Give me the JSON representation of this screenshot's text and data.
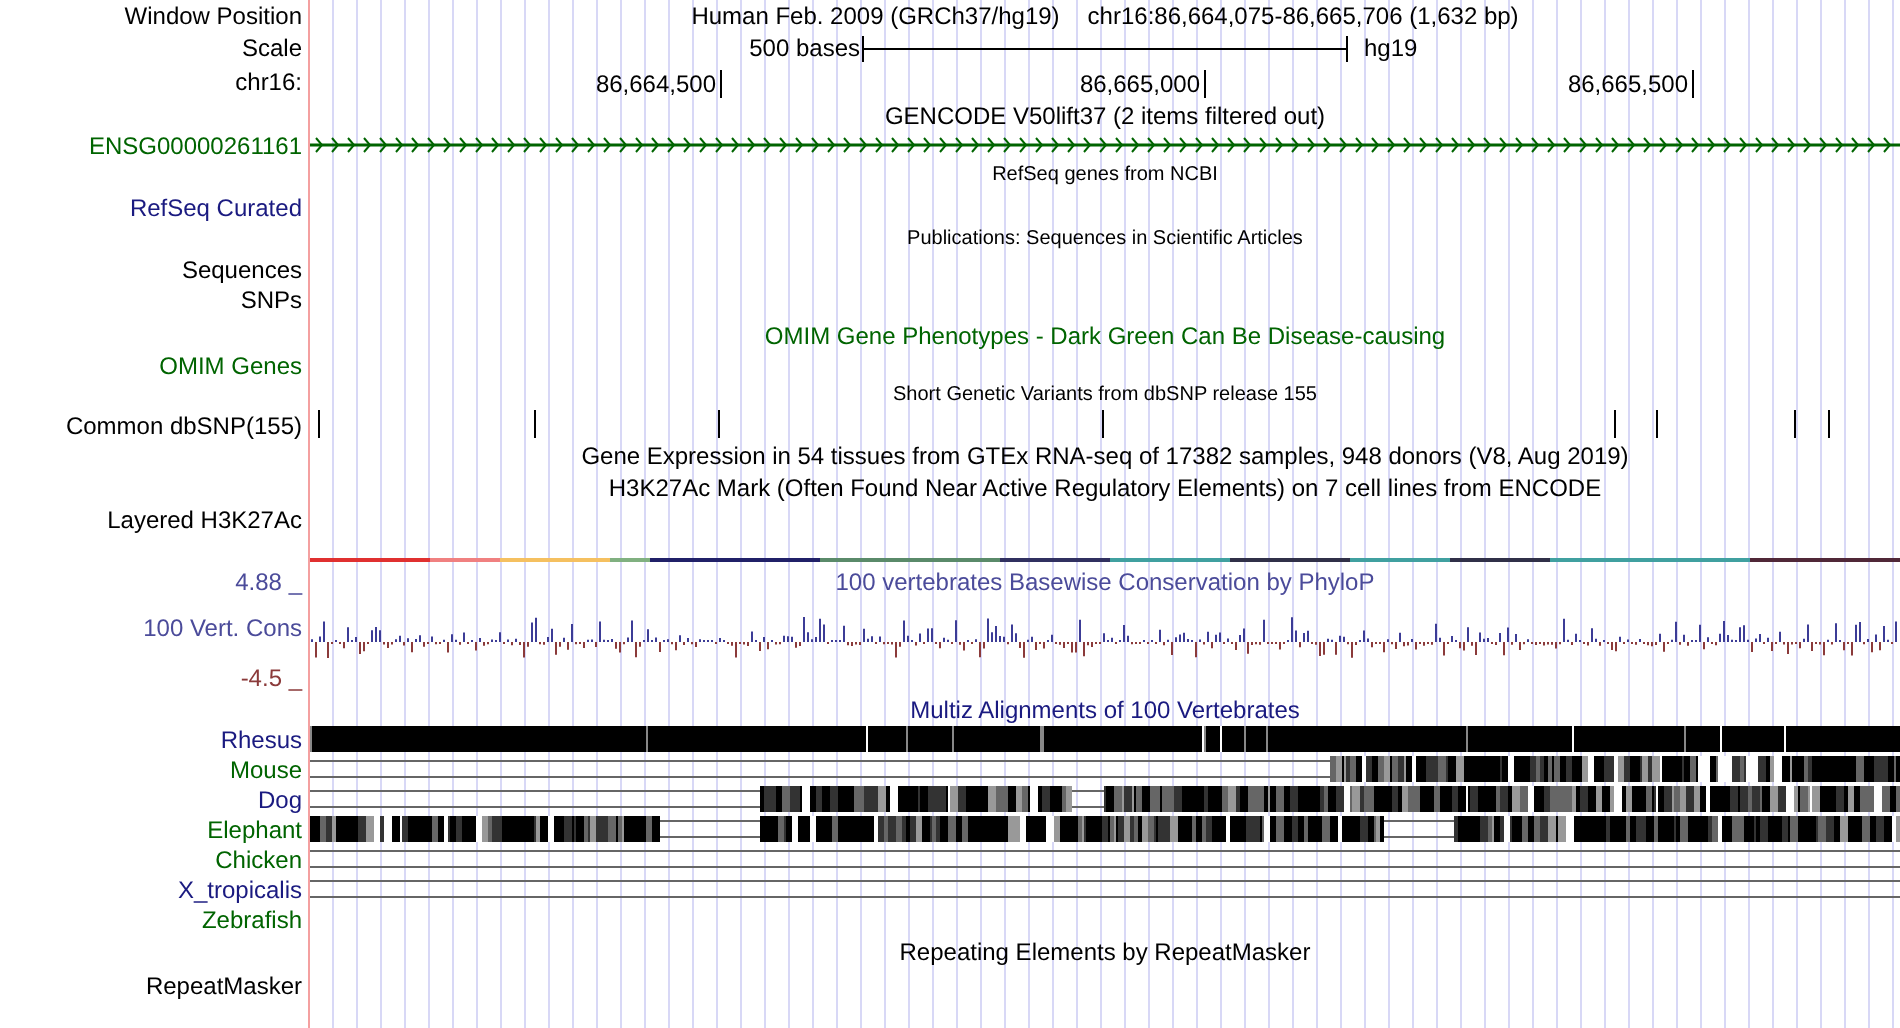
{
  "header": {
    "window_label": "Window Position",
    "title": "Human Feb. 2009 (GRCh37/hg19)",
    "position": "chr16:86,664,075-86,665,706 (1,632 bp)",
    "scale_label": "Scale",
    "scale_text": "500 bases",
    "assembly": "hg19",
    "chrom_label": "chr16:",
    "ruler_ticks": [
      "86,664,500",
      "86,665,000",
      "86,665,500"
    ]
  },
  "tracks": [
    {
      "kind": "gene",
      "title": {
        "text": "GENCODE V50lift37 (2 items filtered out)",
        "color": "#000000"
      },
      "label": {
        "text": "ENSG00000261161",
        "color": "#006400"
      }
    },
    {
      "kind": "empty",
      "title": {
        "text": "RefSeq genes from NCBI",
        "color": "#000000"
      },
      "label": {
        "text": "RefSeq Curated",
        "color": "#1a1a80"
      }
    },
    {
      "kind": "publications",
      "title": {
        "text": "Publications: Sequences in Scientific Articles",
        "color": "#000000"
      },
      "labels": [
        {
          "text": "Sequences",
          "color": "#000000"
        },
        {
          "text": "SNPs",
          "color": "#000000"
        }
      ]
    },
    {
      "kind": "omim",
      "title": {
        "text": "OMIM Gene Phenotypes - Dark Green Can Be Disease-causing",
        "color": "#006400"
      },
      "label": {
        "text": "OMIM Genes",
        "color": "#006400"
      }
    },
    {
      "kind": "snp",
      "title": {
        "text": "Short Genetic Variants from dbSNP release 155",
        "color": "#000000"
      },
      "label": {
        "text": "Common dbSNP(155)",
        "color": "#000000"
      }
    },
    {
      "kind": "title",
      "title": {
        "text": "Gene Expression in 54 tissues from GTEx RNA-seq of 17382 samples, 948 donors (V8, Aug 2019)",
        "color": "#000000"
      }
    },
    {
      "kind": "signal",
      "title": {
        "text": "H3K27Ac Mark (Often Found Near Active Regulatory Elements) on 7 cell lines from ENCODE",
        "color": "#000000"
      },
      "label": {
        "text": "Layered H3K27Ac",
        "color": "#000000"
      }
    },
    {
      "kind": "wiggle",
      "title": {
        "text": "100 vertebrates Basewise Conservation by PhyloP",
        "color": "#4b4b9a"
      },
      "label": {
        "text": "100 Vert. Cons",
        "color": "#4b4b9a"
      },
      "max": {
        "text": "4.88 _",
        "color": "#4b4b9a"
      },
      "min": {
        "text": "-4.5 _",
        "color": "#8b3a3a"
      }
    },
    {
      "kind": "multiz",
      "title": {
        "text": "Multiz Alignments of 100 Vertebrates",
        "color": "#1a1a80"
      },
      "species": [
        {
          "name": "Rhesus",
          "color": "#1a1a80"
        },
        {
          "name": "Mouse",
          "color": "#006400"
        },
        {
          "name": "Dog",
          "color": "#1a1a80"
        },
        {
          "name": "Elephant",
          "color": "#006400"
        },
        {
          "name": "Chicken",
          "color": "#006400"
        },
        {
          "name": "X_tropicalis",
          "color": "#1a1a80"
        },
        {
          "name": "Zebrafish",
          "color": "#006400"
        }
      ]
    },
    {
      "kind": "repeat",
      "title": {
        "text": "Repeating Elements by RepeatMasker",
        "color": "#000000"
      },
      "label": {
        "text": "RepeatMasker",
        "color": "#000000"
      }
    }
  ]
}
